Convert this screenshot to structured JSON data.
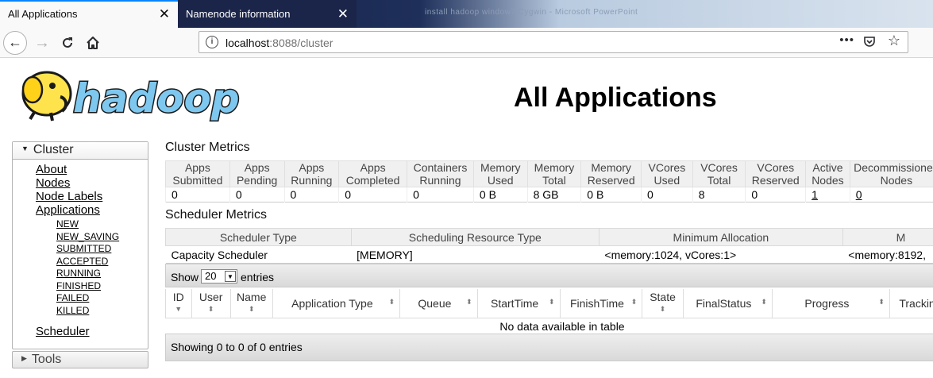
{
  "browser": {
    "tabs": [
      {
        "label": "All Applications",
        "active": true
      },
      {
        "label": "Namenode information",
        "active": false
      }
    ],
    "blurred_window_title": "install hadoop window7 Cygwin - Microsoft PowerPoint",
    "url_host": "localhost",
    "url_path": ":8088/cluster",
    "url_more": "•••"
  },
  "header": {
    "logo_text": "hadoop",
    "title": "All Applications"
  },
  "nav": {
    "cluster_label": "Cluster",
    "items": [
      "About",
      "Nodes",
      "Node Labels",
      "Applications"
    ],
    "app_states": [
      "NEW",
      "NEW_SAVING",
      "SUBMITTED",
      "ACCEPTED",
      "RUNNING",
      "FINISHED",
      "FAILED",
      "KILLED"
    ],
    "scheduler_label": "Scheduler",
    "tools_label": "Tools"
  },
  "cluster_metrics": {
    "title": "Cluster Metrics",
    "headers": [
      [
        "Apps",
        "Submitted"
      ],
      [
        "Apps",
        "Pending"
      ],
      [
        "Apps",
        "Running"
      ],
      [
        "Apps",
        "Completed"
      ],
      [
        "Containers",
        "Running"
      ],
      [
        "Memory",
        "Used"
      ],
      [
        "Memory",
        "Total"
      ],
      [
        "Memory",
        "Reserved"
      ],
      [
        "VCores",
        "Used"
      ],
      [
        "VCores",
        "Total"
      ],
      [
        "VCores",
        "Reserved"
      ],
      [
        "Active",
        "Nodes"
      ],
      [
        "Decommissioned",
        "Nodes"
      ]
    ],
    "values": [
      "0",
      "0",
      "0",
      "0",
      "0",
      "0 B",
      "8 GB",
      "0 B",
      "0",
      "8",
      "0",
      "1",
      "0"
    ]
  },
  "scheduler_metrics": {
    "title": "Scheduler Metrics",
    "headers": [
      "Scheduler Type",
      "Scheduling Resource Type",
      "Minimum Allocation",
      "M"
    ],
    "values": [
      "Capacity Scheduler",
      "[MEMORY]",
      "<memory:1024, vCores:1>",
      "<memory:8192, "
    ]
  },
  "applications_table": {
    "show_label": "Show",
    "page_size": "20",
    "entries_label": "entries",
    "columns": [
      "ID",
      "User",
      "Name",
      "Application Type",
      "Queue",
      "StartTime",
      "FinishTime",
      "State",
      "FinalStatus",
      "Progress",
      "Tracking"
    ],
    "empty_message": "No data available in table",
    "footer": "Showing 0 to 0 of 0 entries"
  }
}
